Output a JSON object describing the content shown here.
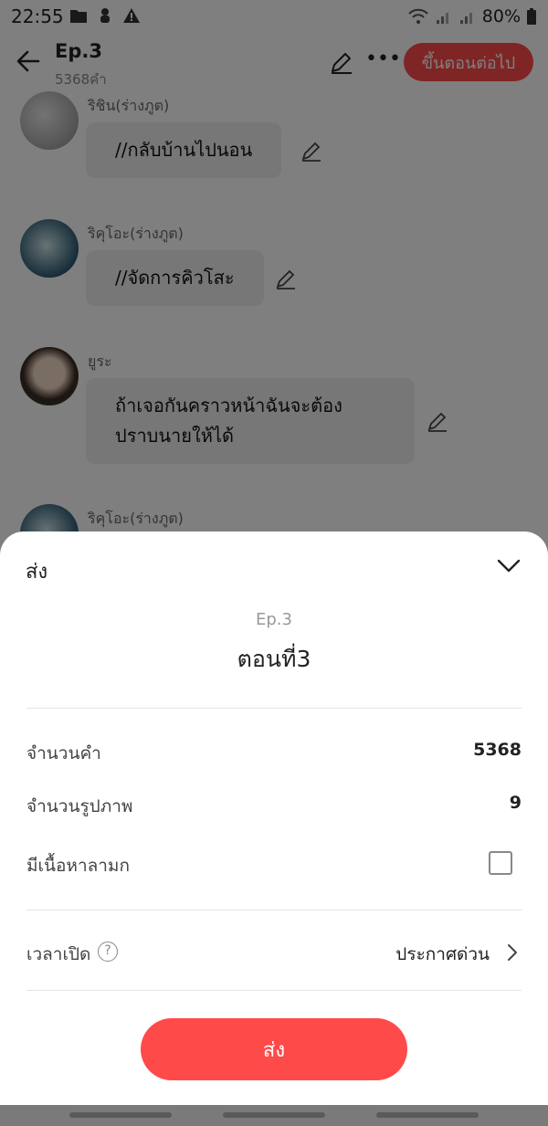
{
  "status_bar": {
    "time": "22:55",
    "battery": "80%",
    "icons_left": [
      "folder-icon",
      "android-bug-icon",
      "warning-icon"
    ],
    "icons_right": [
      "wifi-icon",
      "signal-icon",
      "signal-icon",
      "battery-icon"
    ]
  },
  "header": {
    "title": "Ep.3",
    "word_count": "5368คำ",
    "next_button": "ขึ้นตอนต่อไป"
  },
  "messages": [
    {
      "speaker": "ริชิน(ร่างภูต)",
      "text": "//กลับบ้านไปนอน"
    },
    {
      "speaker": "ริคุโอะ(ร่างภูต)",
      "text": "//จัดการคิวโสะ"
    },
    {
      "speaker": "ยูระ",
      "text": "ถ้าเจอกันคราวหน้าฉันจะต้อง\nปราบนายให้ได้"
    },
    {
      "speaker": "ริคุโอะ(ร่างภูต)",
      "text": ""
    }
  ],
  "sheet": {
    "title": "ส่ง",
    "episode": "Ep.3",
    "episode_name": "ตอนที่3",
    "rows": {
      "word_count_label": "จำนวนคำ",
      "word_count_value": "5368",
      "image_count_label": "จำนวนรูปภาพ",
      "image_count_value": "9",
      "mature_label": "มีเนื้อหาลามก",
      "mature_checked": false,
      "publish_time_label": "เวลาเปิด",
      "publish_time_value": "ประกาศด่วน"
    },
    "submit_button": "ส่ง"
  },
  "colors": {
    "accent": "#ff4a4a",
    "overlay": "rgba(0,0,0,0.5)"
  }
}
